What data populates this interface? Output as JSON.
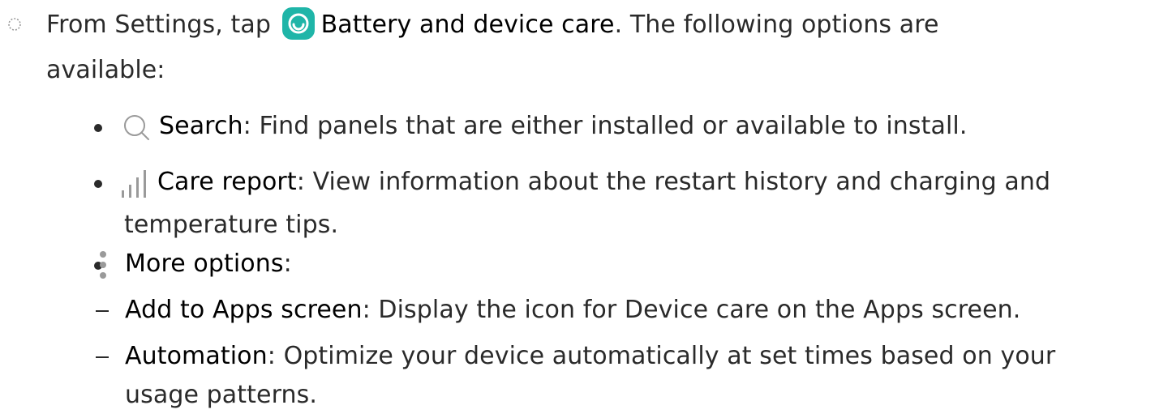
{
  "step": {
    "part1": "From Settings, tap",
    "app_name": "Battery and device care",
    "part2": ". The following options are",
    "part3": "available:",
    "app_icon": "battery-device-care-icon"
  },
  "options": [
    {
      "icon": "search-icon",
      "term": "Search",
      "desc": ": Find panels that are either installed or available to install."
    },
    {
      "icon": "bar-chart-icon",
      "term": "Care report",
      "desc": ": View information about the restart history and charging and",
      "desc2": "temperature tips."
    },
    {
      "icon": "more-options-icon",
      "term": "More options",
      "desc": ":"
    }
  ],
  "sub_options": [
    {
      "term": "Add to Apps screen",
      "desc": ": Display the icon for Device care on the Apps screen."
    },
    {
      "term": "Automation",
      "desc": ": Optimize your device automatically at set times based on your",
      "desc2": "usage patterns."
    }
  ],
  "colors": {
    "app_icon_bg": "#1fb5a8",
    "text": "#2a2a2a",
    "icon_gray": "#9a9a9a"
  }
}
